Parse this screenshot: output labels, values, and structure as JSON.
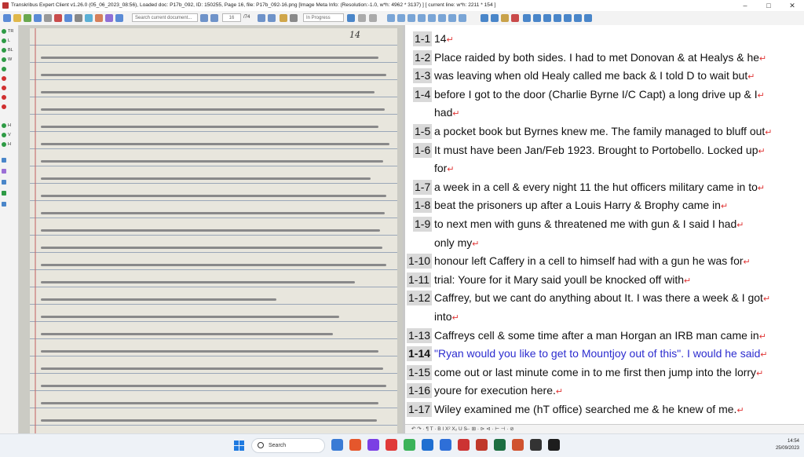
{
  "window": {
    "title": "Transkribus Expert Client v1.26.0 (05_06_2023_08:56), Loaded doc: P17b_092, ID: 150255, Page 16, file: P17b_092-16.png [Image Meta Info: (Resolution:-1.0, w*h: 4962 * 3137) ] [ current line: w*h: 2211 * 154 ]",
    "minimize": "–",
    "maximize": "□",
    "close": "✕"
  },
  "toolbar": {
    "search_placeholder": "Search current document...",
    "page_current": "16",
    "page_total": "/74",
    "status_value": "In Progress"
  },
  "sidebar": {
    "items": [
      {
        "label": "TR",
        "color": "#2e9b45"
      },
      {
        "label": "L",
        "color": "#2e9b45"
      },
      {
        "label": "BL",
        "color": "#2e9b45"
      },
      {
        "label": "W",
        "color": "#2e9b45"
      },
      {
        "label": "",
        "color": "#2e9b45"
      },
      {
        "label": "",
        "color": "#d03030"
      },
      {
        "label": "",
        "color": "#d03030"
      },
      {
        "label": "",
        "color": "#d03030"
      },
      {
        "label": "",
        "color": "#d03030"
      },
      {
        "label": "H",
        "color": "#2e9b45"
      },
      {
        "label": "V",
        "color": "#2e9b45"
      },
      {
        "label": "H",
        "color": "#2e9b45"
      }
    ]
  },
  "image": {
    "page_number": "14"
  },
  "transcript": {
    "lines": [
      {
        "num": "1-1",
        "text": "14",
        "current": false
      },
      {
        "num": "1-2",
        "text": "Place raided by both sides. I had to met Donovan & at Healys & he",
        "current": false
      },
      {
        "num": "1-3",
        "text": "was leaving when old Healy called me back & I told D to wait but",
        "current": false
      },
      {
        "num": "1-4",
        "text": "before I got to the door (Charlie Byrne I/C Capt) a long drive up & I",
        "current": false
      },
      {
        "num": "",
        "text": "had",
        "current": false
      },
      {
        "num": "1-5",
        "text": "a pocket book but Byrnes knew me. The family managed to bluff out",
        "current": false
      },
      {
        "num": "1-6",
        "text": "It must have been Jan/Feb 1923. Brought to Portobello. Locked up",
        "current": false
      },
      {
        "num": "",
        "text": "for",
        "current": false
      },
      {
        "num": "1-7",
        "text": "a week in a cell & every night 11 the hut officers military came in to",
        "current": false
      },
      {
        "num": "1-8",
        "text": "beat the prisoners up after a Louis Harry & Brophy came in",
        "current": false
      },
      {
        "num": "1-9",
        "text": "to next men with guns & threatened me with gun & I said I had",
        "current": false
      },
      {
        "num": "",
        "text": "only my",
        "current": false
      },
      {
        "num": "1-10",
        "text": "honour left Caffery in a cell to himself had with a gun he was for",
        "current": false
      },
      {
        "num": "1-11",
        "text": "trial: Youre for it Mary said youll be knocked off with",
        "current": false
      },
      {
        "num": "1-12",
        "text": "Caffrey, but we cant do anything about It. I was there a week & I got",
        "current": false
      },
      {
        "num": "",
        "text": "into",
        "current": false
      },
      {
        "num": "1-13",
        "text": "Caffreys cell & some time after a man Horgan an IRB man came in",
        "current": false
      },
      {
        "num": "1-14",
        "text": "\"Ryan would you like to get to Mountjoy out of this\". I would he said",
        "current": true
      },
      {
        "num": "1-15",
        "text": "come out or last minute come in to me first then jump into the lorry",
        "current": false
      },
      {
        "num": "1-16",
        "text": "youre for execution here.",
        "current": false
      },
      {
        "num": "1-17",
        "text": "Wiley examined me (hT office) searched me & he knew of me.",
        "current": false
      }
    ]
  },
  "format_bar": {
    "text": "↶ ↷ · ¶ T · B I X² X₂ U S̶ · ⊞ · ⊳ ⊲ · ⊢ ⊣ · ⊘"
  },
  "taskbar": {
    "search_label": "Search",
    "time": "14:54",
    "date": "25/09/2023",
    "apps": [
      "#3a7bd5",
      "#e5572c",
      "#7b3fe4",
      "#e03a3a",
      "#3bb35a",
      "#1f6fd1",
      "#2e6fd8",
      "#c33",
      "#c0392b",
      "#1d6f42",
      "#d0532f",
      "#333333",
      "#1d1d1d"
    ]
  }
}
